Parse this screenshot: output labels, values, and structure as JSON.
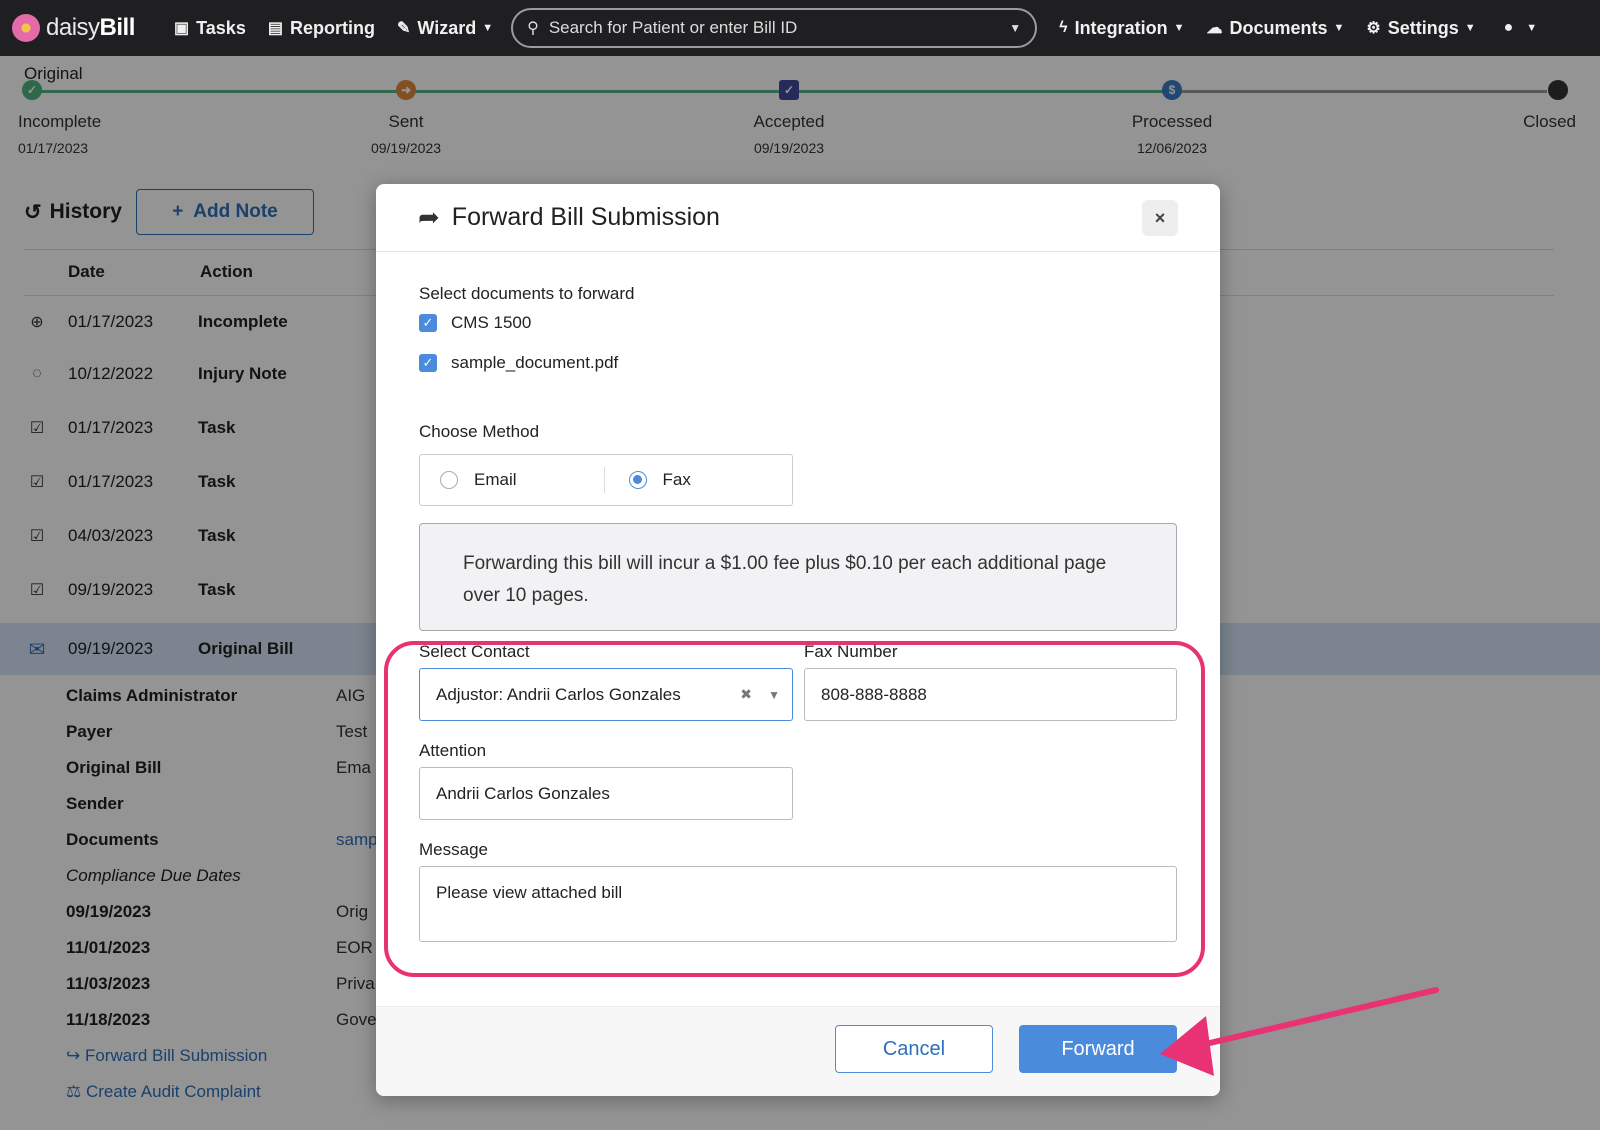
{
  "nav": {
    "brand_prefix": "daisy",
    "brand_suffix": "Bill",
    "items": [
      {
        "label": "Tasks",
        "icon": "clipboard-icon"
      },
      {
        "label": "Reporting",
        "icon": "bar-chart-icon"
      },
      {
        "label": "Wizard",
        "icon": "magic-wand-icon"
      }
    ],
    "search_placeholder": "Search for Patient or enter Bill ID",
    "right_items": [
      {
        "label": "Integration",
        "icon": "lightning-icon"
      },
      {
        "label": "Documents",
        "icon": "cloud-icon"
      },
      {
        "label": "Settings",
        "icon": "gear-icon"
      }
    ]
  },
  "status": {
    "title": "Original",
    "steps": [
      {
        "label": "Incomplete",
        "date": "01/17/2023"
      },
      {
        "label": "Sent",
        "date": "09/19/2023"
      },
      {
        "label": "Accepted",
        "date": "09/19/2023"
      },
      {
        "label": "Processed",
        "date": "12/06/2023"
      },
      {
        "label": "Closed",
        "date": ""
      }
    ]
  },
  "history": {
    "title": "History",
    "add_note": "Add Note",
    "col_date": "Date",
    "col_action": "Action",
    "rows": [
      {
        "date": "01/17/2023",
        "action": "Incomplete"
      },
      {
        "date": "10/12/2022",
        "action": "Injury Note"
      },
      {
        "date": "01/17/2023",
        "action": "Task"
      },
      {
        "date": "01/17/2023",
        "action": "Task"
      },
      {
        "date": "04/03/2023",
        "action": "Task"
      },
      {
        "date": "09/19/2023",
        "action": "Task"
      },
      {
        "date": "09/19/2023",
        "action": "Original Bill"
      }
    ],
    "details": [
      {
        "label": "Claims Administrator",
        "value": "AIG"
      },
      {
        "label": "Payer",
        "value": "Test"
      },
      {
        "label": "Original Bill",
        "value": "Ema"
      },
      {
        "label": "Sender",
        "value": ""
      },
      {
        "label": "Documents",
        "value": "samp"
      },
      {
        "label": "Compliance Due Dates",
        "value": ""
      },
      {
        "label": "09/19/2023",
        "value": "Orig"
      },
      {
        "label": "11/01/2023",
        "value": "EOR"
      },
      {
        "label": "11/03/2023",
        "value": "Priva"
      },
      {
        "label": "11/18/2023",
        "value": "Gove"
      }
    ],
    "links": [
      "Forward Bill Submission",
      "Create Audit Complaint"
    ]
  },
  "modal": {
    "title": "Forward Bill Submission",
    "close_label": "×",
    "docs_label": "Select documents to forward",
    "docs": [
      "CMS 1500",
      "sample_document.pdf"
    ],
    "method_label": "Choose Method",
    "methods": [
      "Email",
      "Fax"
    ],
    "selected_method": "Fax",
    "notice": "Forwarding this bill will incur a $1.00 fee plus $0.10 per each additional page over 10 pages.",
    "contact_label": "Select Contact",
    "contact_value": "Adjustor: Andrii Carlos Gonzales",
    "fax_label": "Fax Number",
    "fax_value": "808-888-8888",
    "attention_label": "Attention",
    "attention_value": "Andrii Carlos Gonzales",
    "message_label": "Message",
    "message_value": "Please view attached bill",
    "cancel": "Cancel",
    "forward": "Forward"
  },
  "colors": {
    "accent": "#4a8bdc",
    "highlight": "#e83273",
    "nav_bg": "#1f1f22"
  }
}
